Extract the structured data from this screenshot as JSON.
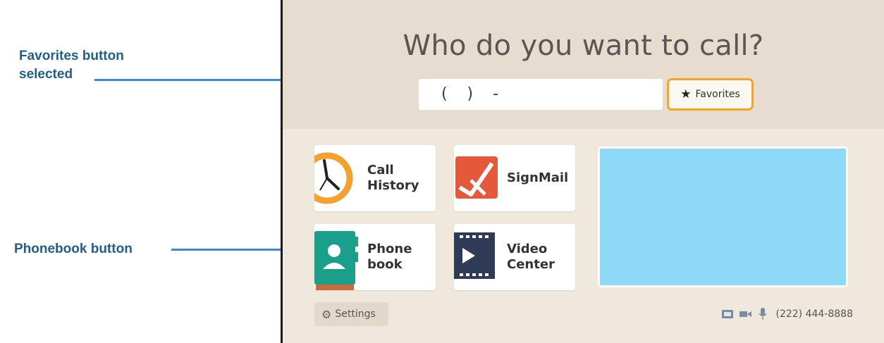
{
  "annotations": {
    "favorites_callout": "Favorites button selected",
    "phonebook_callout": "Phonebook button"
  },
  "screen": {
    "title": "Who do you want to call?",
    "phone_input": "(    )    -",
    "favorites_label": "Favorites",
    "tiles": [
      {
        "label": "Call History",
        "icon": "clock-icon"
      },
      {
        "label": "SignMail",
        "icon": "signmail-icon"
      },
      {
        "label": "Phone book",
        "icon": "phonebook-icon"
      },
      {
        "label": "Video Center",
        "icon": "video-center-icon"
      }
    ],
    "settings_label": "Settings",
    "status_number": "(222) 444-8888"
  },
  "colors": {
    "accent_selected": "#f5a623",
    "callout_text": "#1f5f8b",
    "arrow": "#3b8ad9",
    "video_preview": "#8ed9f8",
    "header_bg": "#e6dccf"
  }
}
